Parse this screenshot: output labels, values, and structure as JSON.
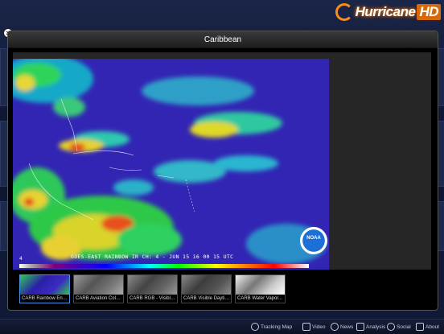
{
  "brand": {
    "name": "Hurricane",
    "badge": "HD"
  },
  "modal": {
    "title": "Caribbean",
    "close_glyph": "×"
  },
  "viewer": {
    "caption": "GOES-EAST RAINBOW IR CH: 4  -  JUN 15 16 00 15 UTC",
    "colorbar_min": "4",
    "logo_text": "NOAA"
  },
  "thumbnails": [
    {
      "label": "CARB Rainbow Enha...",
      "selected": true
    },
    {
      "label": "CARB Aviation Color...",
      "selected": false
    },
    {
      "label": "CARB RGB - Visible, I...",
      "selected": false
    },
    {
      "label": "CARB Visible Daytim...",
      "selected": false
    },
    {
      "label": "CARB Water Vapor...",
      "selected": false
    }
  ],
  "nav": {
    "tracking_map": "Tracking Map",
    "video": "Video",
    "news": "News",
    "analysis": "Analysis",
    "social": "Social",
    "about": "About"
  },
  "colors": {
    "accent": "#d86b0e",
    "selected": "#4a90e2"
  }
}
